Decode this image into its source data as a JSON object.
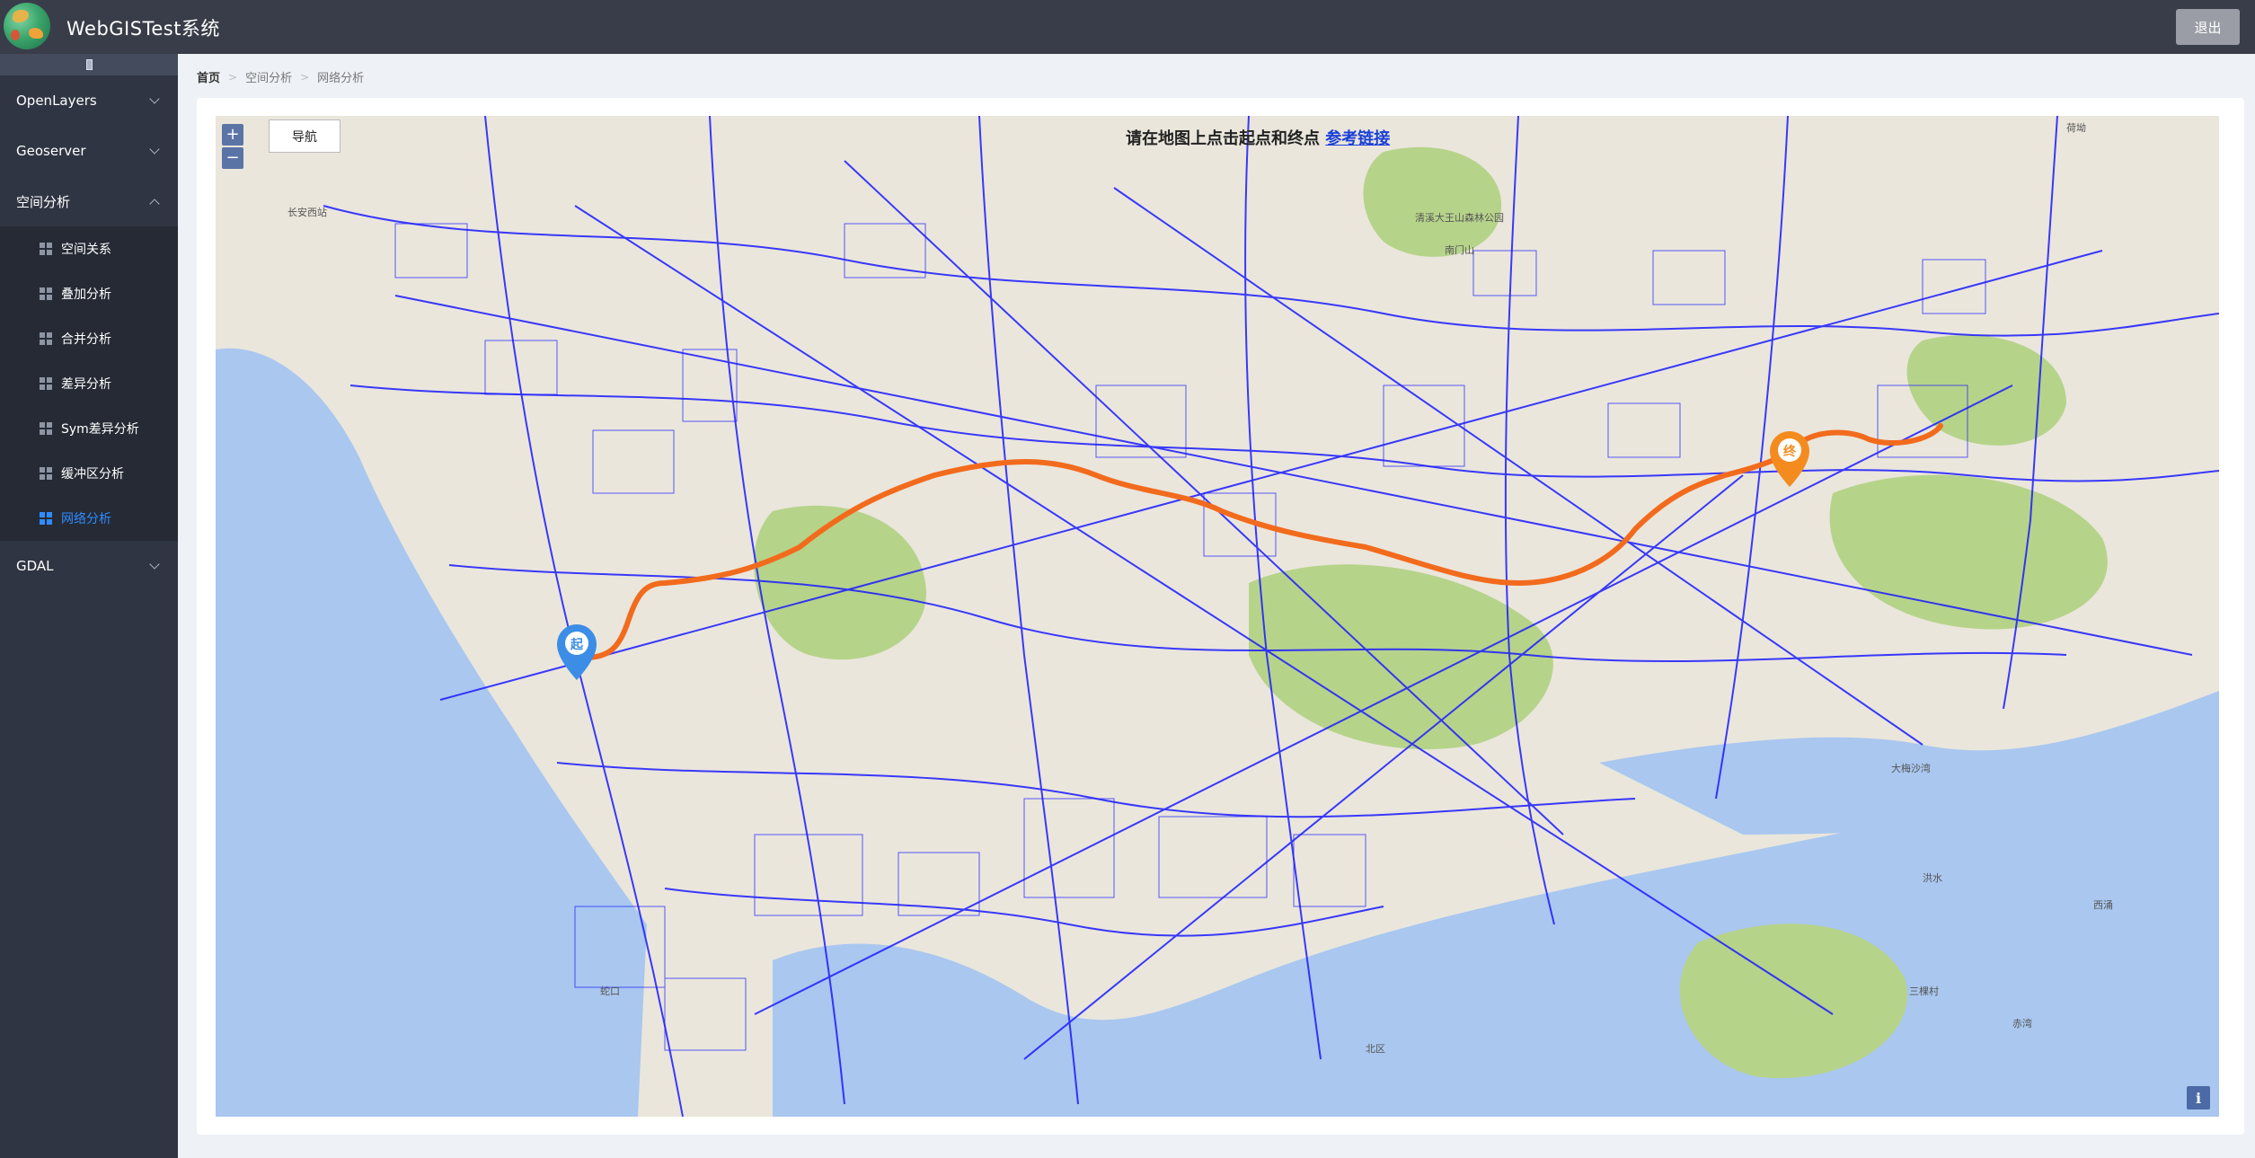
{
  "header": {
    "title": "WebGISTest系统",
    "logout_label": "退出"
  },
  "sidebar": {
    "menus": [
      {
        "label": "OpenLayers",
        "expanded": false
      },
      {
        "label": "Geoserver",
        "expanded": false
      },
      {
        "label": "空间分析",
        "expanded": true,
        "items": [
          {
            "label": "空间关系",
            "active": false
          },
          {
            "label": "叠加分析",
            "active": false
          },
          {
            "label": "合并分析",
            "active": false
          },
          {
            "label": "差异分析",
            "active": false
          },
          {
            "label": "Sym差异分析",
            "active": false
          },
          {
            "label": "缓冲区分析",
            "active": false
          },
          {
            "label": "网络分析",
            "active": true
          }
        ]
      },
      {
        "label": "GDAL",
        "expanded": false
      }
    ]
  },
  "breadcrumb": [
    "首页",
    "空间分析",
    "网络分析"
  ],
  "map": {
    "zoom_in": "+",
    "zoom_out": "−",
    "nav_button": "导航",
    "instruction": "请在地图上点击起点和终点",
    "reference_link": "参考链接",
    "start_marker": "起",
    "end_marker": "终",
    "info_button": "i",
    "colors": {
      "route": "#f26b1d",
      "roads": "#1a1aff",
      "water": "#a9c7ef",
      "green": "#b6d38a",
      "start": "#3c8de6",
      "end": "#f48b1f"
    },
    "place_labels": [
      "长安西站",
      "清溪大王山森林公园",
      "南门山",
      "大梅沙湾",
      "西涌",
      "洪水",
      "赤湾",
      "三棵村",
      "北区",
      "蛇口",
      "荷坳"
    ]
  }
}
